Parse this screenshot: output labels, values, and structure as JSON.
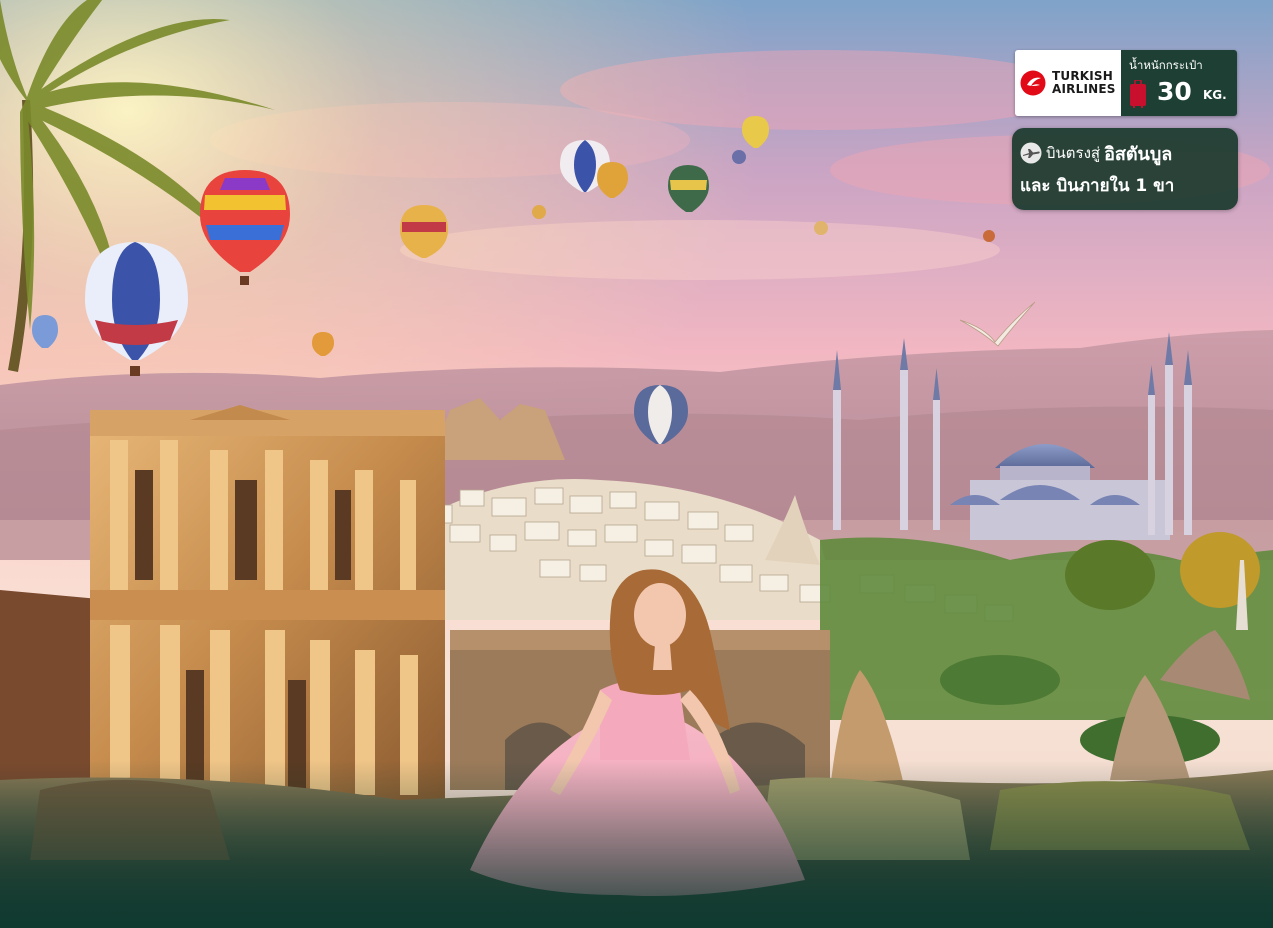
{
  "airline": {
    "name_line1": "TURKISH",
    "name_line2": "AIRLINES",
    "logo_icon": "turkish-airlines-logo-icon",
    "brand_color": "#e30a17"
  },
  "baggage": {
    "label": "น้ำหนักกระเป๋า",
    "value": "30",
    "unit": "KG.",
    "icon": "luggage-icon",
    "panel_color": "#1d3f34"
  },
  "flight_info": {
    "icon": "plane-icon",
    "line1_prefix": "บินตรงสู่",
    "line1_destination": "อิสตันบูล",
    "line2": "และ บินภายใน 1 ขา",
    "panel_color": "#1c3a2e"
  }
}
